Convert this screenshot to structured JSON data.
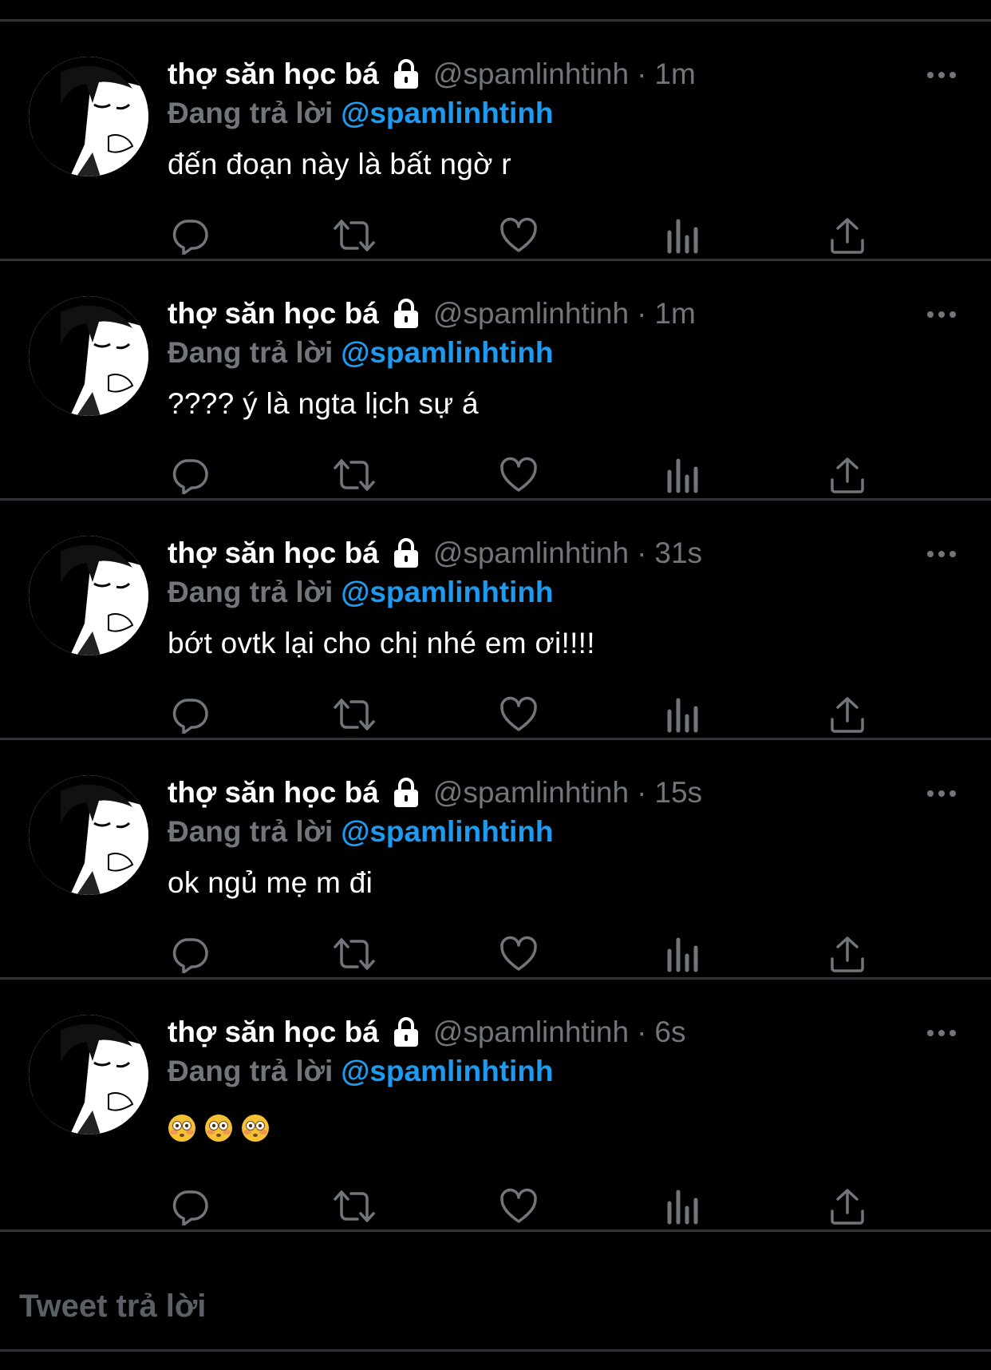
{
  "app": {
    "icons": {
      "lock": "lock-icon",
      "more": "more-horizontal-icon",
      "reply": "reply-bubble-icon",
      "retweet": "retweet-icon",
      "like": "heart-icon",
      "views": "views-bars-icon",
      "share": "share-upload-icon"
    },
    "colors": {
      "background": "#000000",
      "divider": "#2f3336",
      "secondary_text": "#71767b",
      "link": "#1d9bf0",
      "primary_text": "#ffffff"
    }
  },
  "tweets": [
    {
      "display_name": "thợ săn học bá",
      "handle": "@spamlinhtinh",
      "separator": "·",
      "time": "1m",
      "reply_prefix": "Đang trả lời",
      "reply_to": "@spamlinhtinh",
      "text": "đến đoạn này là bất ngờ r"
    },
    {
      "display_name": "thợ săn học bá",
      "handle": "@spamlinhtinh",
      "separator": "·",
      "time": "1m",
      "reply_prefix": "Đang trả lời",
      "reply_to": "@spamlinhtinh",
      "text": "???? ý là ngta lịch sự á"
    },
    {
      "display_name": "thợ săn học bá",
      "handle": "@spamlinhtinh",
      "separator": "·",
      "time": "31s",
      "reply_prefix": "Đang trả lời",
      "reply_to": "@spamlinhtinh",
      "text": "bớt ovtk lại cho chị nhé em ơi!!!!"
    },
    {
      "display_name": "thợ săn học bá",
      "handle": "@spamlinhtinh",
      "separator": "·",
      "time": "15s",
      "reply_prefix": "Đang trả lời",
      "reply_to": "@spamlinhtinh",
      "text": "ok ngủ mẹ m đi"
    },
    {
      "display_name": "thợ săn học bá",
      "handle": "@spamlinhtinh",
      "separator": "·",
      "time": "6s",
      "reply_prefix": "Đang trả lời",
      "reply_to": "@spamlinhtinh",
      "text": "😳😳😳",
      "emojis": [
        "flushed-face-emoji",
        "flushed-face-emoji",
        "flushed-face-emoji"
      ]
    }
  ],
  "composer": {
    "placeholder": "Tweet trả lời"
  }
}
